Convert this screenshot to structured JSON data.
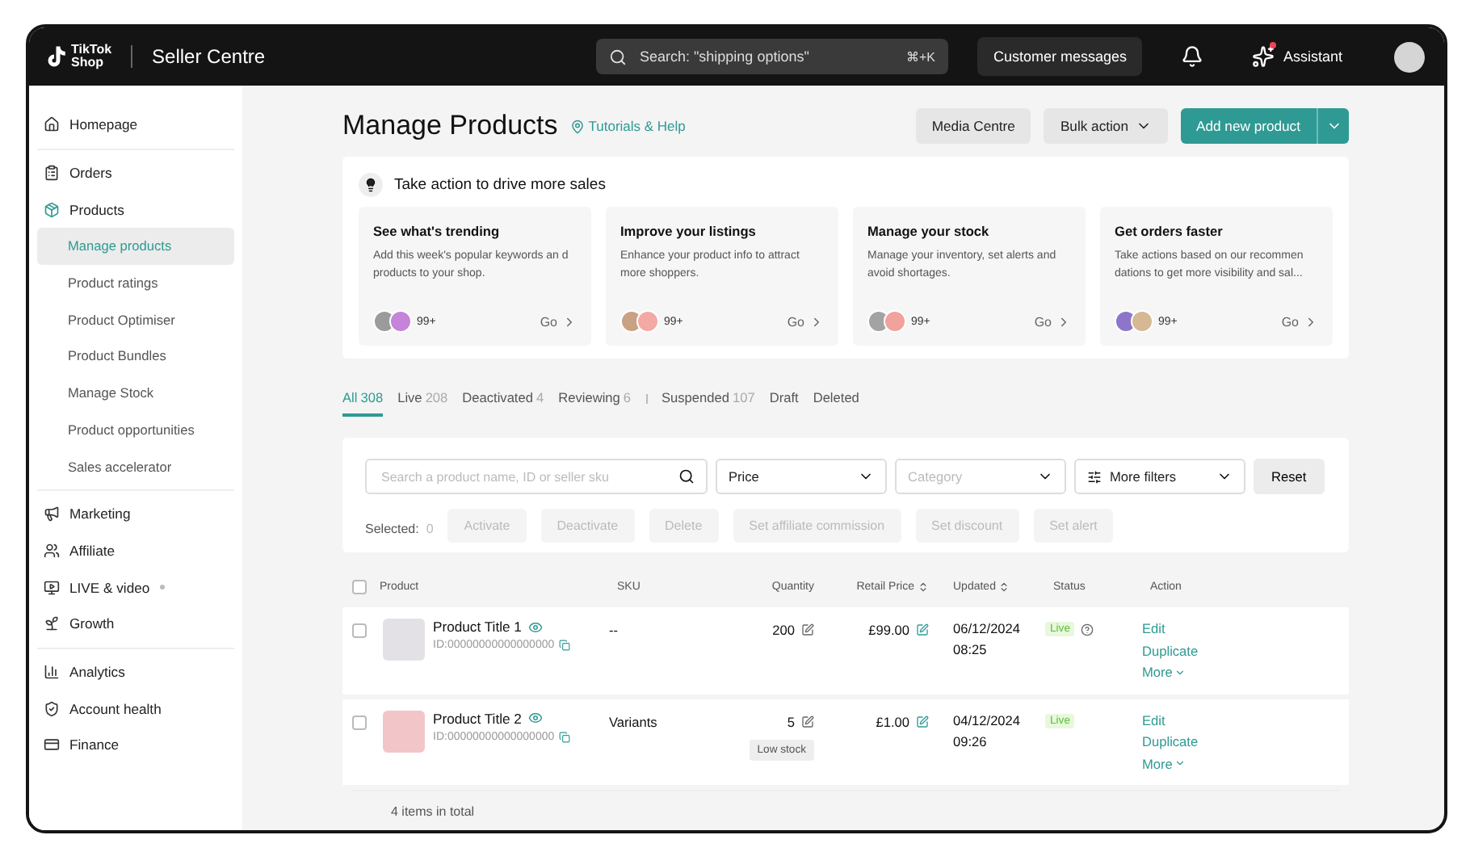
{
  "topbar": {
    "logo_lines": [
      "TikTok",
      "Shop"
    ],
    "title": "Seller Centre",
    "search_placeholder": "Search: \"shipping options\"",
    "shortcut": "⌘+K",
    "messages_button": "Customer messages",
    "assistant_button": "Assistant",
    "assistant_dot": true
  },
  "sidebar": {
    "groups": [
      {
        "items": [
          {
            "label": "Homepage",
            "selected": false
          }
        ]
      },
      {
        "items": [
          {
            "label": "Orders",
            "selected": false
          },
          {
            "label": "Products",
            "selected": false,
            "expanded": true,
            "children": [
              {
                "label": "Manage products",
                "selected": true
              },
              {
                "label": "Product ratings",
                "selected": false
              },
              {
                "label": "Product Optimiser",
                "selected": false
              },
              {
                "label": "Product Bundles",
                "selected": false
              },
              {
                "label": "Manage Stock",
                "selected": false
              },
              {
                "label": "Product opportunities",
                "selected": false
              },
              {
                "label": "Sales accelerator",
                "selected": false
              }
            ]
          }
        ]
      },
      {
        "items": [
          {
            "label": "Marketing",
            "selected": false
          },
          {
            "label": "Affiliate",
            "selected": false
          },
          {
            "label": "LIVE & video",
            "selected": false,
            "dot": true
          },
          {
            "label": "Growth",
            "selected": false
          }
        ]
      },
      {
        "items": [
          {
            "label": "Analytics",
            "selected": false
          },
          {
            "label": "Account health",
            "selected": false
          },
          {
            "label": "Finance",
            "selected": false
          }
        ]
      }
    ]
  },
  "page": {
    "title": "Manage Products",
    "help_link": "Tutorials & Help",
    "buttons": [
      {
        "label": "Media Centre",
        "kind": "plain"
      },
      {
        "label": "Bulk action",
        "kind": "dropdown"
      },
      {
        "label": "Add new product",
        "kind": "primary"
      }
    ]
  },
  "actions_panel": {
    "title": "Take action to drive more sales",
    "cards": [
      {
        "title": "See what's trending",
        "text": "Add this week's popular keywords an d products to your shop.",
        "count": "99+",
        "go": "Go"
      },
      {
        "title": "Improve your listings",
        "text": "Enhance your product info to attract more shoppers.",
        "count": "99+",
        "go": "Go"
      },
      {
        "title": "Manage your stock",
        "text": "Manage your inventory, set alerts and avoid shortages.",
        "count": "99+",
        "go": "Go"
      },
      {
        "title": "Get orders faster",
        "text": "Take actions based on our recommen dations to get more visibility and sal...",
        "count": "99+",
        "go": "Go"
      }
    ]
  },
  "tabs": [
    {
      "label": "All",
      "count": "308",
      "selected": true
    },
    {
      "label": "Live",
      "count": "208",
      "selected": false
    },
    {
      "label": "Deactivated",
      "count": "4",
      "selected": false
    },
    {
      "label": "Reviewing",
      "count": "6",
      "selected": false
    },
    {
      "label": "Suspended",
      "count": "107",
      "selected": false,
      "separator_before": true
    },
    {
      "label": "Draft",
      "selected": false
    },
    {
      "label": "Deleted",
      "selected": false
    }
  ],
  "filters": {
    "search_placeholder": "Search a product name, ID or seller sku",
    "price": "Price",
    "category_placeholder": "Category",
    "more_filters": "More filters",
    "reset": "Reset"
  },
  "bulk": {
    "label": "Selected:",
    "count": "0",
    "actions": [
      {
        "label": "Activate",
        "disabled": true
      },
      {
        "label": "Deactivate",
        "disabled": true
      },
      {
        "label": "Delete",
        "disabled": true
      },
      {
        "label": "Set affiliate commission",
        "disabled": true
      },
      {
        "label": "Set discount",
        "disabled": true
      },
      {
        "label": "Set alert",
        "disabled": true
      }
    ]
  },
  "table": {
    "select_all_checked": false,
    "columns": [
      {
        "label": "Product",
        "sortable": false
      },
      {
        "label": "SKU",
        "sortable": false
      },
      {
        "label": "Quantity",
        "sortable": false
      },
      {
        "label": "Retail Price",
        "sortable": true
      },
      {
        "label": "Updated",
        "sortable": true
      },
      {
        "label": "Status",
        "sortable": false
      },
      {
        "label": "Action",
        "sortable": false
      }
    ],
    "rows": [
      {
        "checked": false,
        "title": "Product Title 1",
        "id": "ID:00000000000000000",
        "sku": "--",
        "quantity": "200",
        "price": "£99.00",
        "date": "06/12/2024",
        "time": "08:25",
        "status": "Live",
        "status_help": true,
        "actions": [
          "Edit",
          "Duplicate",
          "More"
        ]
      },
      {
        "checked": false,
        "title": "Product Title 2",
        "id": "ID:00000000000000000",
        "sku": "Variants",
        "quantity": "5",
        "badge": "Low stock",
        "price": "£1.00",
        "date": "04/12/2024",
        "time": "09:26",
        "status": "Live",
        "status_help": false,
        "actions": [
          "Edit",
          "Duplicate",
          "More"
        ]
      }
    ],
    "footer": "4 items in total"
  }
}
